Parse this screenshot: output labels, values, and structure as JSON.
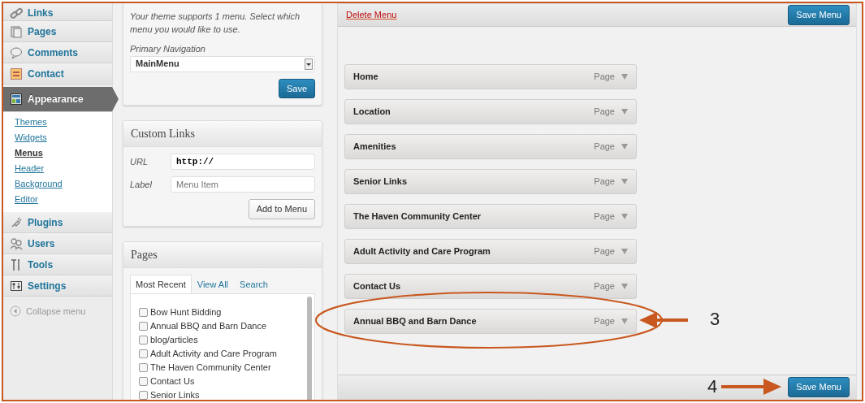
{
  "sidebar": {
    "items": [
      {
        "label": "Links",
        "selected": false
      },
      {
        "label": "Pages",
        "selected": false
      },
      {
        "label": "Comments",
        "selected": false
      },
      {
        "label": "Contact",
        "selected": false
      },
      {
        "label": "Appearance",
        "selected": true,
        "children": [
          {
            "label": "Themes",
            "selected": false
          },
          {
            "label": "Widgets",
            "selected": false
          },
          {
            "label": "Menus",
            "selected": true
          },
          {
            "label": "Header",
            "selected": false
          },
          {
            "label": "Background",
            "selected": false
          },
          {
            "label": "Editor",
            "selected": false
          }
        ]
      },
      {
        "label": "Plugins",
        "selected": false
      },
      {
        "label": "Users",
        "selected": false
      },
      {
        "label": "Tools",
        "selected": false
      },
      {
        "label": "Settings",
        "selected": false
      }
    ],
    "collapse": "Collapse menu"
  },
  "theme_locations": {
    "note": "Your theme supports 1 menu. Select which menu you would like to use.",
    "label": "Primary Navigation",
    "value": "MainMenu",
    "button": "Save"
  },
  "custom_links": {
    "title": "Custom Links",
    "url_label": "URL",
    "url_value": "http://",
    "label_label": "Label",
    "label_placeholder": "Menu Item",
    "button": "Add to Menu"
  },
  "pages": {
    "title": "Pages",
    "tabs": [
      {
        "label": "Most Recent",
        "selected": true
      },
      {
        "label": "View All",
        "selected": false
      },
      {
        "label": "Search",
        "selected": false
      }
    ],
    "items": [
      {
        "label": "Bow Hunt Bidding",
        "checked": false
      },
      {
        "label": "Annual BBQ and Barn Dance",
        "checked": false
      },
      {
        "label": "blog/articles",
        "checked": false
      },
      {
        "label": "Adult Activity and Care Program",
        "checked": false
      },
      {
        "label": "The Haven Community Center",
        "checked": false
      },
      {
        "label": "Contact Us",
        "checked": false
      },
      {
        "label": "Senior Links",
        "checked": false
      }
    ]
  },
  "menu": {
    "delete": "Delete Menu",
    "save_top": "Save Menu",
    "save_bottom": "Save Menu",
    "items": [
      {
        "title": "Home",
        "type": "Page"
      },
      {
        "title": "Location",
        "type": "Page"
      },
      {
        "title": "Amenities",
        "type": "Page"
      },
      {
        "title": "Senior Links",
        "type": "Page"
      },
      {
        "title": "The Haven Community Center",
        "type": "Page"
      },
      {
        "title": "Adult Activity and Care Program",
        "type": "Page"
      },
      {
        "title": "Contact Us",
        "type": "Page"
      },
      {
        "title": "Annual BBQ and Barn Dance",
        "type": "Page"
      }
    ]
  },
  "annotations": [
    {
      "label": "3"
    },
    {
      "label": "4"
    }
  ]
}
